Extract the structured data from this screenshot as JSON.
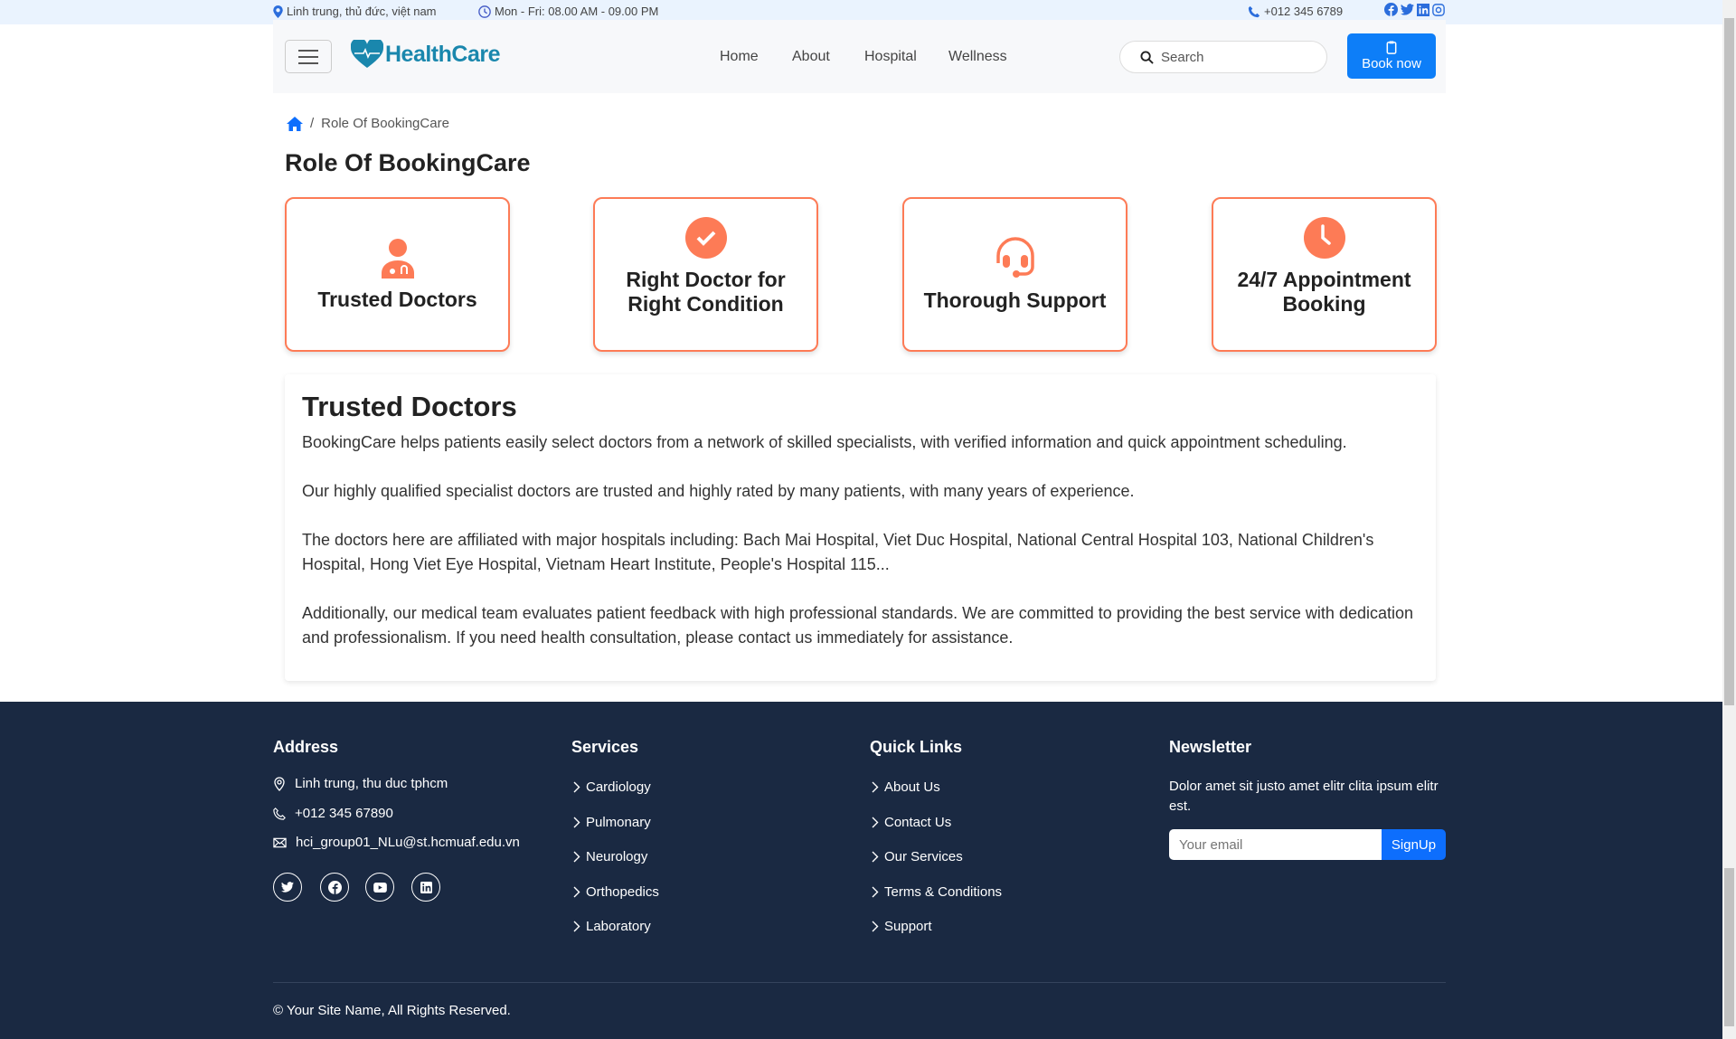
{
  "topbar": {
    "address": "Linh trung, thủ đức, việt nam",
    "hours": "Mon - Fri: 08.00 AM - 09.00 PM",
    "phone": "+012 345 6789"
  },
  "header": {
    "logo": "HealthCare",
    "nav": [
      "Home",
      "About",
      "Hospital",
      "Wellness"
    ],
    "search_placeholder": "Search",
    "book_label": "Book now"
  },
  "breadcrumb": {
    "current": "Role Of BookingCare"
  },
  "page_title": "Role Of BookingCare",
  "cards": [
    "Trusted Doctors",
    "Right Doctor for Right Condition",
    "Thorough Support",
    "24/7 Appointment Booking"
  ],
  "content": {
    "heading": "Trusted Doctors",
    "paragraphs": [
      "BookingCare helps patients easily select doctors from a network of skilled specialists, with verified information and quick appointment scheduling.",
      "Our highly qualified specialist doctors are trusted and highly rated by many patients, with many years of experience.",
      "The doctors here are affiliated with major hospitals including: Bach Mai Hospital, Viet Duc Hospital, National Central Hospital 103, National Children's Hospital, Hong Viet Eye Hospital, Vietnam Heart Institute, People's Hospital 115...",
      "Additionally, our medical team evaluates patient feedback with high professional standards. We are committed to providing the best service with dedication and professionalism. If you need health consultation, please contact us immediately for assistance."
    ]
  },
  "footer": {
    "address": {
      "title": "Address",
      "location": "Linh trung, thu duc tphcm",
      "phone": "+012 345 67890",
      "email": "hci_group01_NLu@st.hcmuaf.edu.vn"
    },
    "services": {
      "title": "Services",
      "items": [
        "Cardiology",
        "Pulmonary",
        "Neurology",
        "Orthopedics",
        "Laboratory"
      ]
    },
    "quick_links": {
      "title": "Quick Links",
      "items": [
        "About Us",
        "Contact Us",
        "Our Services",
        "Terms & Conditions",
        "Support"
      ]
    },
    "newsletter": {
      "title": "Newsletter",
      "text": "Dolor amet sit justo amet elitr clita ipsum elitr est.",
      "placeholder": "Your email",
      "button": "SignUp"
    },
    "copyright": "© Your Site Name, All Rights Reserved."
  },
  "colors": {
    "accent": "#fd7b56",
    "primary": "#0d6efd",
    "footer_bg": "#1a2942",
    "logo": "#1a87ad"
  }
}
